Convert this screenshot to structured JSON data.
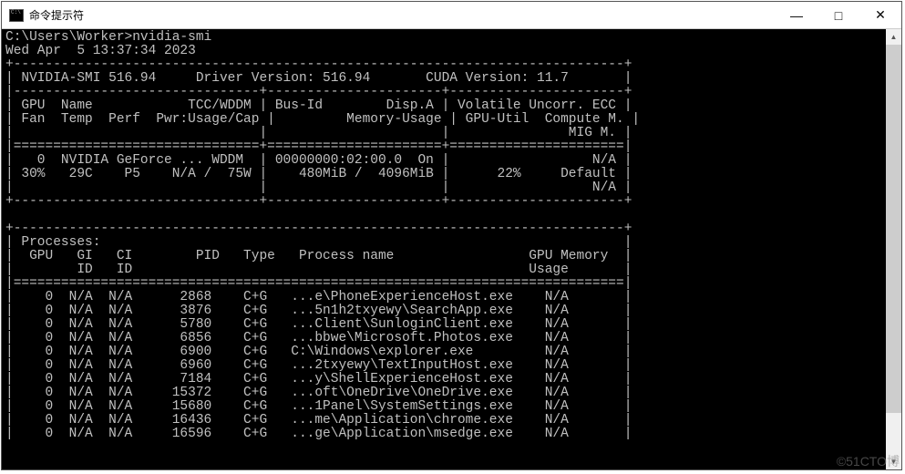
{
  "window": {
    "title": "命令提示符",
    "minimize": "—",
    "maximize": "□",
    "close": "✕"
  },
  "prompt": "C:\\Users\\Worker>",
  "command": "nvidia-smi",
  "timestamp": "Wed Apr  5 13:37:34 2023",
  "header": {
    "smi_version": "NVIDIA-SMI 516.94",
    "driver_version": "Driver Version: 516.94",
    "cuda_version": "CUDA Version: 11.7"
  },
  "gpu_cols": {
    "row1": {
      "c1": "GPU  Name            TCC/WDDM",
      "c2": "Bus-Id        Disp.A",
      "c3": "Volatile Uncorr. ECC"
    },
    "row2": {
      "c1": "Fan  Temp  Perf  Pwr:Usage/Cap",
      "c2": "        Memory-Usage",
      "c3": "GPU-Util  Compute M."
    },
    "row3": {
      "c1": "",
      "c2": "",
      "c3": "              MIG M."
    }
  },
  "gpu_row": {
    "r1": {
      "c1": "  0  NVIDIA GeForce ... WDDM ",
      "c2": "00000000:02:00.0  On",
      "c3": "                 N/A"
    },
    "r2": {
      "c1": "30%   29C    P5    N/A /  75W",
      "c2": "   480MiB /  4096MiB",
      "c3": "     22%     Default"
    },
    "r3": {
      "c1": "",
      "c2": "",
      "c3": "                 N/A"
    }
  },
  "proc_header": {
    "title": "Processes:",
    "h1": {
      "c1": " GPU   GI   CI        PID   Type   Process name",
      "c2": "GPU Memory"
    },
    "h2": {
      "c1": "       ID   ID",
      "c2": "Usage     "
    }
  },
  "processes": [
    {
      "gpu": "0",
      "gi": "N/A",
      "ci": "N/A",
      "pid": "2868",
      "type": "C+G",
      "name": "...e\\PhoneExperienceHost.exe",
      "mem": "N/A"
    },
    {
      "gpu": "0",
      "gi": "N/A",
      "ci": "N/A",
      "pid": "3876",
      "type": "C+G",
      "name": "...5n1h2txyewy\\SearchApp.exe",
      "mem": "N/A"
    },
    {
      "gpu": "0",
      "gi": "N/A",
      "ci": "N/A",
      "pid": "5780",
      "type": "C+G",
      "name": "...Client\\SunloginClient.exe",
      "mem": "N/A"
    },
    {
      "gpu": "0",
      "gi": "N/A",
      "ci": "N/A",
      "pid": "6856",
      "type": "C+G",
      "name": "...bbwe\\Microsoft.Photos.exe",
      "mem": "N/A"
    },
    {
      "gpu": "0",
      "gi": "N/A",
      "ci": "N/A",
      "pid": "6900",
      "type": "C+G",
      "name": "C:\\Windows\\explorer.exe     ",
      "mem": "N/A"
    },
    {
      "gpu": "0",
      "gi": "N/A",
      "ci": "N/A",
      "pid": "6960",
      "type": "C+G",
      "name": "...2txyewy\\TextInputHost.exe",
      "mem": "N/A"
    },
    {
      "gpu": "0",
      "gi": "N/A",
      "ci": "N/A",
      "pid": "7184",
      "type": "C+G",
      "name": "...y\\ShellExperienceHost.exe",
      "mem": "N/A"
    },
    {
      "gpu": "0",
      "gi": "N/A",
      "ci": "N/A",
      "pid": "15372",
      "type": "C+G",
      "name": "...oft\\OneDrive\\OneDrive.exe",
      "mem": "N/A"
    },
    {
      "gpu": "0",
      "gi": "N/A",
      "ci": "N/A",
      "pid": "15680",
      "type": "C+G",
      "name": "...1Panel\\SystemSettings.exe",
      "mem": "N/A"
    },
    {
      "gpu": "0",
      "gi": "N/A",
      "ci": "N/A",
      "pid": "16436",
      "type": "C+G",
      "name": "...me\\Application\\chrome.exe",
      "mem": "N/A"
    },
    {
      "gpu": "0",
      "gi": "N/A",
      "ci": "N/A",
      "pid": "16596",
      "type": "C+G",
      "name": "...ge\\Application\\msedge.exe",
      "mem": "N/A"
    }
  ],
  "watermark": "©51CTO博"
}
